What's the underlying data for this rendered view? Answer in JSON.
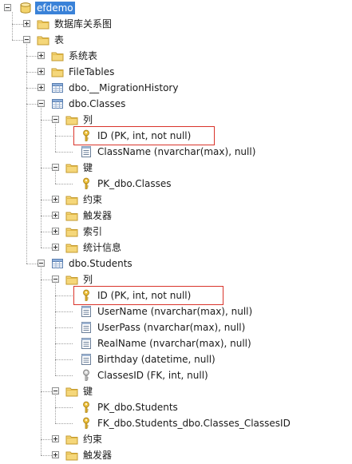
{
  "tree": {
    "root": {
      "label": "efdemo",
      "icon": "database-icon",
      "expanded": true,
      "selected": true
    },
    "items": [
      {
        "id": "db-diagrams",
        "label": "数据库关系图",
        "icon": "folder-icon",
        "toggle": "plus"
      },
      {
        "id": "tables-folder",
        "label": "表",
        "icon": "folder-icon",
        "toggle": "minus"
      },
      {
        "id": "system-tables",
        "label": "系统表",
        "icon": "folder-icon",
        "toggle": "plus"
      },
      {
        "id": "filetables",
        "label": "FileTables",
        "icon": "folder-icon",
        "toggle": "plus"
      },
      {
        "id": "migration-history",
        "label": "dbo.__MigrationHistory",
        "icon": "table-icon",
        "toggle": "plus"
      },
      {
        "id": "classes-table",
        "label": "dbo.Classes",
        "icon": "table-icon",
        "toggle": "minus"
      },
      {
        "id": "classes-columns",
        "label": "列",
        "icon": "folder-icon",
        "toggle": "minus"
      },
      {
        "id": "classes-col-id",
        "label": "ID (PK, int, not null)",
        "icon": "primary-key-icon",
        "highlighted": true
      },
      {
        "id": "classes-col-classname",
        "label": "ClassName (nvarchar(max), null)",
        "icon": "column-icon"
      },
      {
        "id": "classes-keys",
        "label": "键",
        "icon": "folder-icon",
        "toggle": "minus"
      },
      {
        "id": "classes-pk",
        "label": "PK_dbo.Classes",
        "icon": "primary-key-icon"
      },
      {
        "id": "classes-constraints",
        "label": "约束",
        "icon": "folder-icon",
        "toggle": "plus"
      },
      {
        "id": "classes-triggers",
        "label": "触发器",
        "icon": "folder-icon",
        "toggle": "plus"
      },
      {
        "id": "classes-indexes",
        "label": "索引",
        "icon": "folder-icon",
        "toggle": "plus"
      },
      {
        "id": "classes-statistics",
        "label": "统计信息",
        "icon": "folder-icon",
        "toggle": "plus"
      },
      {
        "id": "students-table",
        "label": "dbo.Students",
        "icon": "table-icon",
        "toggle": "minus"
      },
      {
        "id": "students-columns",
        "label": "列",
        "icon": "folder-icon",
        "toggle": "minus"
      },
      {
        "id": "students-col-id",
        "label": "ID (PK, int, not null)",
        "icon": "primary-key-icon",
        "highlighted": true
      },
      {
        "id": "students-col-username",
        "label": "UserName (nvarchar(max), null)",
        "icon": "column-icon"
      },
      {
        "id": "students-col-userpass",
        "label": "UserPass (nvarchar(max), null)",
        "icon": "column-icon"
      },
      {
        "id": "students-col-realname",
        "label": "RealName (nvarchar(max), null)",
        "icon": "column-icon"
      },
      {
        "id": "students-col-birthday",
        "label": "Birthday (datetime, null)",
        "icon": "column-icon"
      },
      {
        "id": "students-col-classesid",
        "label": "ClassesID (FK, int, null)",
        "icon": "foreign-key-icon"
      },
      {
        "id": "students-keys",
        "label": "键",
        "icon": "folder-icon",
        "toggle": "minus"
      },
      {
        "id": "students-pk",
        "label": "PK_dbo.Students",
        "icon": "primary-key-icon"
      },
      {
        "id": "students-fk",
        "label": "FK_dbo.Students_dbo.Classes_ClassesID",
        "icon": "primary-key-icon"
      },
      {
        "id": "students-constraints",
        "label": "约束",
        "icon": "folder-icon",
        "toggle": "plus"
      },
      {
        "id": "students-triggers",
        "label": "触发器",
        "icon": "folder-icon",
        "toggle": "plus"
      }
    ]
  },
  "colors": {
    "selection": "#3a82d8",
    "highlight_border": "#d9342b",
    "folder": "#e8c25a",
    "key": "#e0a91e"
  }
}
